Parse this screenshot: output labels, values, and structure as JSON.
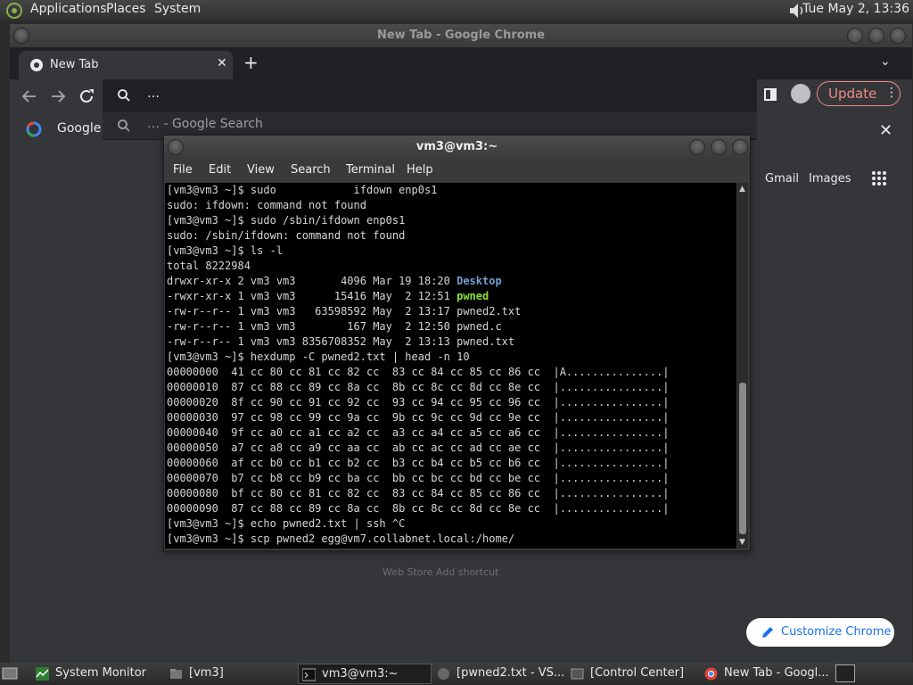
{
  "top_panel": {
    "menus": [
      "Applications",
      "Places",
      "System"
    ],
    "clock": "Tue May  2, 13:36"
  },
  "chrome": {
    "window_title": "New Tab - Google Chrome",
    "tab_label": "New Tab",
    "omnibox_value": "…",
    "suggestion": "… - Google Search",
    "update_label": "Update",
    "bookmark_google": "Google",
    "ntp_gmail": "Gmail",
    "ntp_images": "Images",
    "customize_label": "Customize Chrome",
    "ntp_ghost_text": "Web Store          Add shortcut"
  },
  "terminal": {
    "title": "vm3@vm3:~",
    "menu": [
      "File",
      "Edit",
      "View",
      "Search",
      "Terminal",
      "Help"
    ],
    "lines": [
      "[vm3@vm3 ~]$ sudo            ifdown enp0s1",
      "sudo: ifdown: command not found",
      "[vm3@vm3 ~]$ sudo /sbin/ifdown enp0s1",
      "sudo: /sbin/ifdown: command not found",
      "[vm3@vm3 ~]$ ls -l",
      "total 8222984"
    ],
    "ls_rows": [
      {
        "prefix": "drwxr-xr-x 2 vm3 vm3       4096 Mar 19 18:20 ",
        "name": "Desktop",
        "kind": "dir"
      },
      {
        "prefix": "-rwxr-xr-x 1 vm3 vm3      15416 May  2 12:51 ",
        "name": "pwned",
        "kind": "exe"
      },
      {
        "prefix": "-rw-r--r-- 1 vm3 vm3   63598592 May  2 13:17 ",
        "name": "pwned2.txt",
        "kind": "file"
      },
      {
        "prefix": "-rw-r--r-- 1 vm3 vm3        167 May  2 12:50 ",
        "name": "pwned.c",
        "kind": "file"
      },
      {
        "prefix": "-rw-r--r-- 1 vm3 vm3 8356708352 May  2 13:13 ",
        "name": "pwned.txt",
        "kind": "file"
      }
    ],
    "after_lines": [
      "[vm3@vm3 ~]$ hexdump -C pwned2.txt | head -n 10",
      "00000000  41 cc 80 cc 81 cc 82 cc  83 cc 84 cc 85 cc 86 cc  |A...............|",
      "00000010  87 cc 88 cc 89 cc 8a cc  8b cc 8c cc 8d cc 8e cc  |................|",
      "00000020  8f cc 90 cc 91 cc 92 cc  93 cc 94 cc 95 cc 96 cc  |................|",
      "00000030  97 cc 98 cc 99 cc 9a cc  9b cc 9c cc 9d cc 9e cc  |................|",
      "00000040  9f cc a0 cc a1 cc a2 cc  a3 cc a4 cc a5 cc a6 cc  |................|",
      "00000050  a7 cc a8 cc a9 cc aa cc  ab cc ac cc ad cc ae cc  |................|",
      "00000060  af cc b0 cc b1 cc b2 cc  b3 cc b4 cc b5 cc b6 cc  |................|",
      "00000070  b7 cc b8 cc b9 cc ba cc  bb cc bc cc bd cc be cc  |................|",
      "00000080  bf cc 80 cc 81 cc 82 cc  83 cc 84 cc 85 cc 86 cc  |................|",
      "00000090  87 cc 88 cc 89 cc 8a cc  8b cc 8c cc 8d cc 8e cc  |................|",
      "[vm3@vm3 ~]$ echo pwned2.txt | ssh ^C",
      "[vm3@vm3 ~]$ scp pwned2 egg@vm7.collabnet.local:/home/"
    ],
    "colors": {
      "dir": "#729fcf",
      "exe": "#8ae234",
      "fg": "#d6d6d6",
      "bg": "#000000"
    }
  },
  "taskbar": {
    "tasks": [
      {
        "label": "System Monitor",
        "icon": "system-monitor-icon"
      },
      {
        "label": "[vm3]",
        "icon": "folder-icon"
      },
      {
        "label": "vm3@vm3:~",
        "icon": "terminal-icon"
      },
      {
        "label": "[pwned2.txt - VS...",
        "icon": "editor-icon"
      },
      {
        "label": "[Control Center]",
        "icon": "control-center-icon"
      },
      {
        "label": "New Tab - Googl...",
        "icon": "chrome-icon"
      }
    ]
  }
}
